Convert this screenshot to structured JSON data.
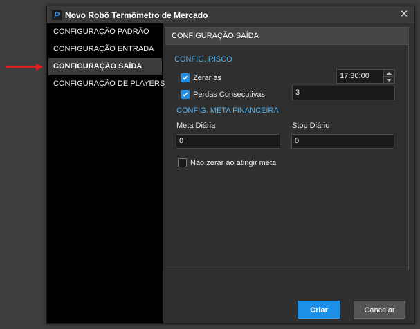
{
  "window": {
    "title": "Novo Robô Termômetro de Mercado",
    "icon": "robot-app-icon",
    "close_icon": "close-icon"
  },
  "sidebar": {
    "items": [
      {
        "label": "CONFIGURAÇÃO PADRÃO",
        "active": false
      },
      {
        "label": "CONFIGURAÇÃO ENTRADA",
        "active": false
      },
      {
        "label": "CONFIGURAÇÃO SAÍDA",
        "active": true
      },
      {
        "label": "CONFIGURAÇÃO DE PLAYERS",
        "active": false
      }
    ]
  },
  "annotation": {
    "icon": "red-arrow-icon",
    "color": "#e0201e"
  },
  "panel": {
    "title": "CONFIGURAÇÃO SAÍDA",
    "risk": {
      "title": "CONFIG. RISCO",
      "zerar": {
        "label": "Zerar às",
        "checked": true,
        "value": "17:30:00"
      },
      "perdas": {
        "label": "Perdas Consecutivas",
        "checked": true,
        "value": "3"
      }
    },
    "meta": {
      "title": "CONFIG. META FINANCEIRA",
      "meta_diaria": {
        "label": "Meta Diária",
        "value": "0"
      },
      "stop_diario": {
        "label": "Stop Diário",
        "value": "0"
      },
      "nao_zerar": {
        "label": "Não zerar ao atingir meta",
        "checked": false
      }
    }
  },
  "footer": {
    "create_label": "Criar",
    "cancel_label": "Cancelar"
  },
  "colors": {
    "accent": "#1e8fe6",
    "section_title": "#5bb0e8",
    "background": "#2f2f2f"
  }
}
